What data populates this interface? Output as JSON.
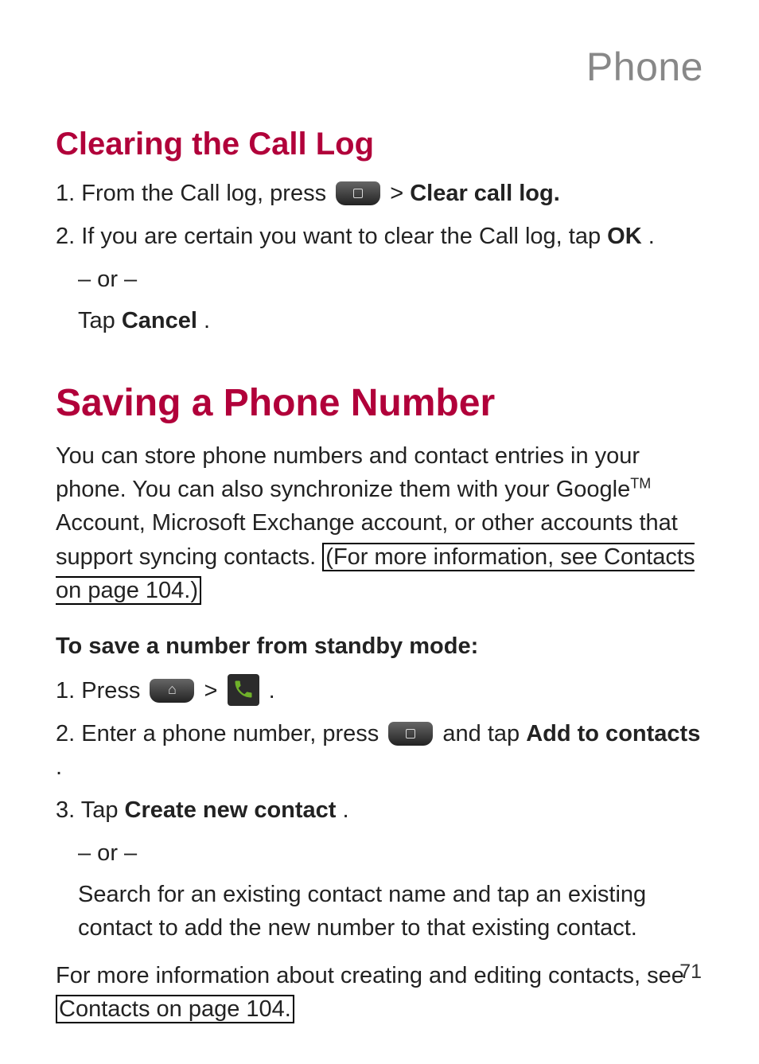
{
  "running_title": "Phone",
  "page_number": "71",
  "h2": "Clearing the Call Log",
  "clear": {
    "step1_a": "1. From the Call log, press ",
    "step1_b": " > ",
    "step1_c": "Clear call log.",
    "step2_a": "2. If you are certain you want to clear the Call log, tap ",
    "step2_b": "OK",
    "step2_c": ".",
    "or": "– or –",
    "tap_a": "Tap ",
    "tap_b": "Cancel",
    "tap_c": "."
  },
  "h1": "Saving a Phone Number",
  "intro": {
    "a": "You can store phone numbers and contact entries in your phone. You can also synchronize them with your Google",
    "tm": "TM",
    "b": " Account, Microsoft Exchange account, or other accounts that support syncing contacts. ",
    "link": "(For more information, see Contacts on page 104.)"
  },
  "sub": "To save a number from standby mode:",
  "save": {
    "s1_a": "1. Press ",
    "s1_b": " > ",
    "s1_c": " .",
    "s2_a": "2. Enter a phone number, press ",
    "s2_b": " and tap ",
    "s2_c": "Add to contacts",
    "s2_d": ".",
    "s3_a": "3. Tap ",
    "s3_b": "Create new contact",
    "s3_c": ".",
    "or": "– or –",
    "alt": "Search for an existing contact name and tap an existing contact to add the new number to that existing contact."
  },
  "footer": {
    "a": "For more information about creating and editing contacts, see ",
    "link": "Contacts on page 104."
  }
}
